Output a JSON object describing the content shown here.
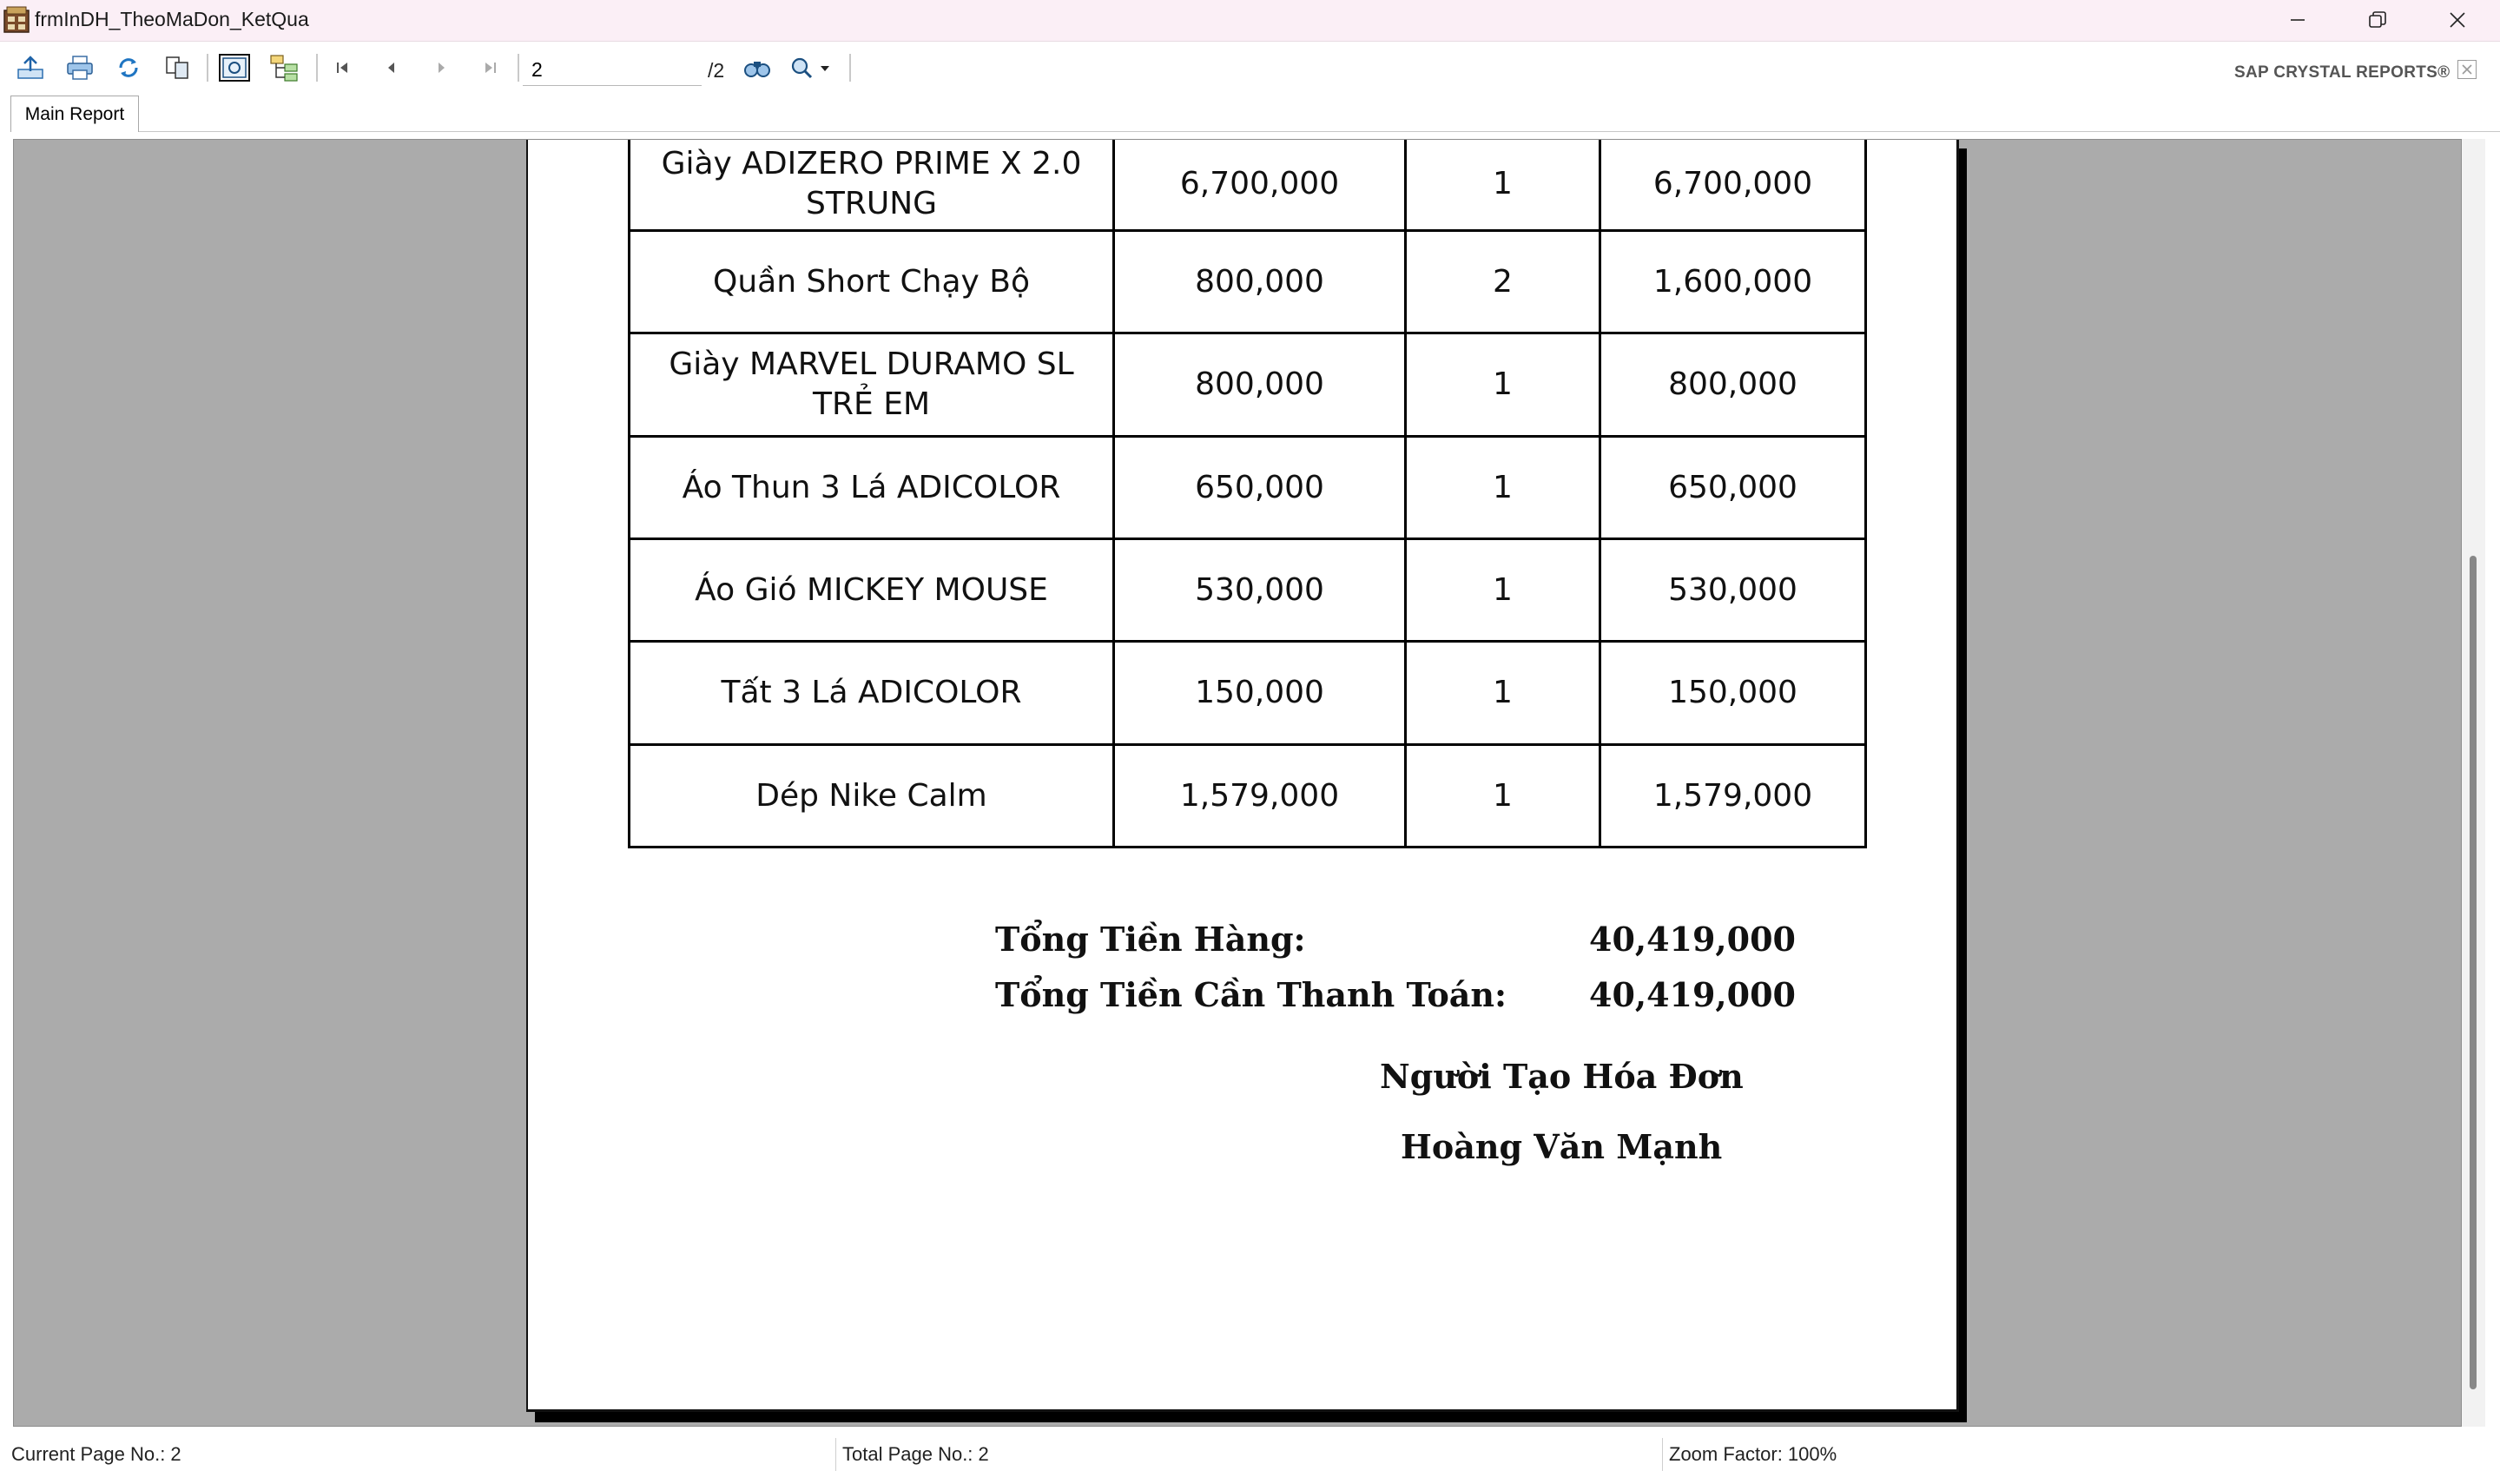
{
  "window": {
    "title": "frmInDH_TheoMaDon_KetQua"
  },
  "toolbar": {
    "current_page_value": "2",
    "total_pages_label": "/2",
    "brand_label": "SAP CRYSTAL REPORTS®"
  },
  "tabs": {
    "main_label": "Main Report"
  },
  "report": {
    "rows": [
      {
        "product": "Giày ADIZERO PRIME X 2.0 STRUNG",
        "price": "6,700,000",
        "qty": "1",
        "total": "6,700,000"
      },
      {
        "product": "Quần Short Chạy Bộ",
        "price": "800,000",
        "qty": "2",
        "total": "1,600,000"
      },
      {
        "product": "Giày MARVEL DURAMO SL TRẺ EM",
        "price": "800,000",
        "qty": "1",
        "total": "800,000"
      },
      {
        "product": "Áo Thun 3 Lá ADICOLOR",
        "price": "650,000",
        "qty": "1",
        "total": "650,000"
      },
      {
        "product": "Áo Gió MICKEY MOUSE",
        "price": "530,000",
        "qty": "1",
        "total": "530,000"
      },
      {
        "product": "Tất 3 Lá ADICOLOR",
        "price": "150,000",
        "qty": "1",
        "total": "150,000"
      },
      {
        "product": "Dép Nike Calm",
        "price": "1,579,000",
        "qty": "1",
        "total": "1,579,000"
      }
    ],
    "subtotal_label": "Tổng Tiền Hàng:",
    "subtotal_value": "40,419,000",
    "grand_total_label": "Tổng Tiền Cần Thanh Toán:",
    "grand_total_value": "40,419,000",
    "creator_label": "Người Tạo Hóa Đơn",
    "creator_name": "Hoàng Văn Mạnh"
  },
  "status": {
    "current_page": "Current Page No.: 2",
    "total_pages": "Total Page No.: 2",
    "zoom": "Zoom Factor: 100%"
  }
}
